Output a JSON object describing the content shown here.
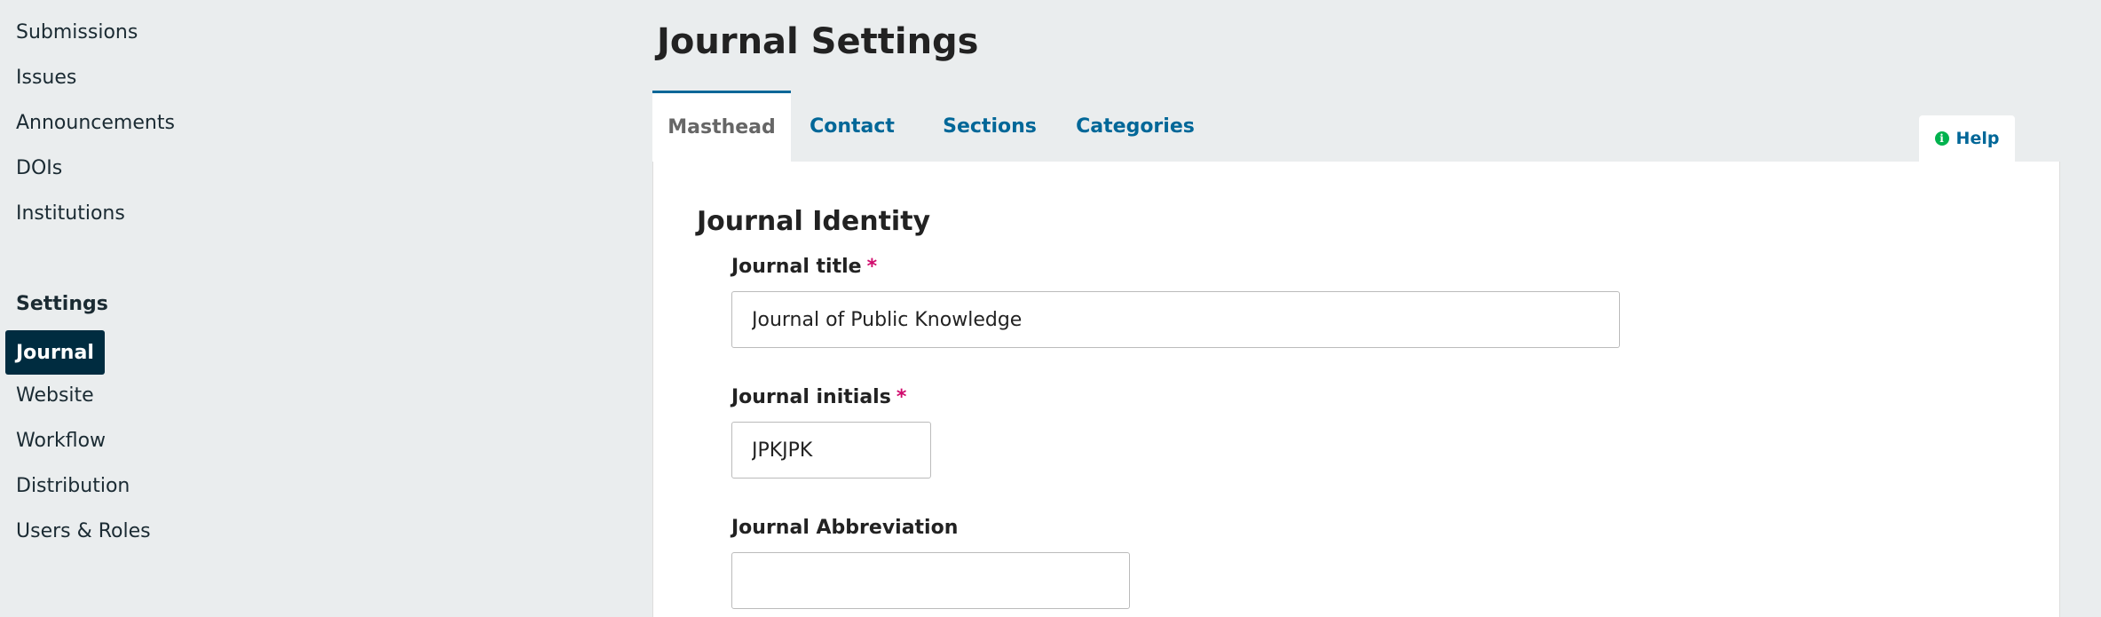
{
  "sidebar": {
    "items": [
      {
        "label": "Submissions"
      },
      {
        "label": "Issues"
      },
      {
        "label": "Announcements"
      },
      {
        "label": "DOIs"
      },
      {
        "label": "Institutions"
      }
    ],
    "settings_heading": "Settings",
    "settings_items": [
      {
        "label": "Journal",
        "active": true
      },
      {
        "label": "Website"
      },
      {
        "label": "Workflow"
      },
      {
        "label": "Distribution"
      },
      {
        "label": "Users & Roles"
      }
    ]
  },
  "header": {
    "title": "Journal Settings"
  },
  "tabs": [
    {
      "label": "Masthead",
      "active": true
    },
    {
      "label": "Contact"
    },
    {
      "label": "Sections"
    },
    {
      "label": "Categories"
    }
  ],
  "help": {
    "label": "Help",
    "icon": "info-circle-icon"
  },
  "form": {
    "section_title": "Journal Identity",
    "fields": [
      {
        "label": "Journal title",
        "required": "*",
        "value": "Journal of Public Knowledge"
      },
      {
        "label": "Journal initials",
        "required": "*",
        "value": "JPKJPK"
      },
      {
        "label": "Journal Abbreviation",
        "value": ""
      }
    ]
  },
  "colors": {
    "accent": "#006798",
    "active_nav_bg": "#002c40",
    "required": "#d00a6c",
    "help_icon": "#00b24e",
    "page_bg": "#eaedee"
  }
}
